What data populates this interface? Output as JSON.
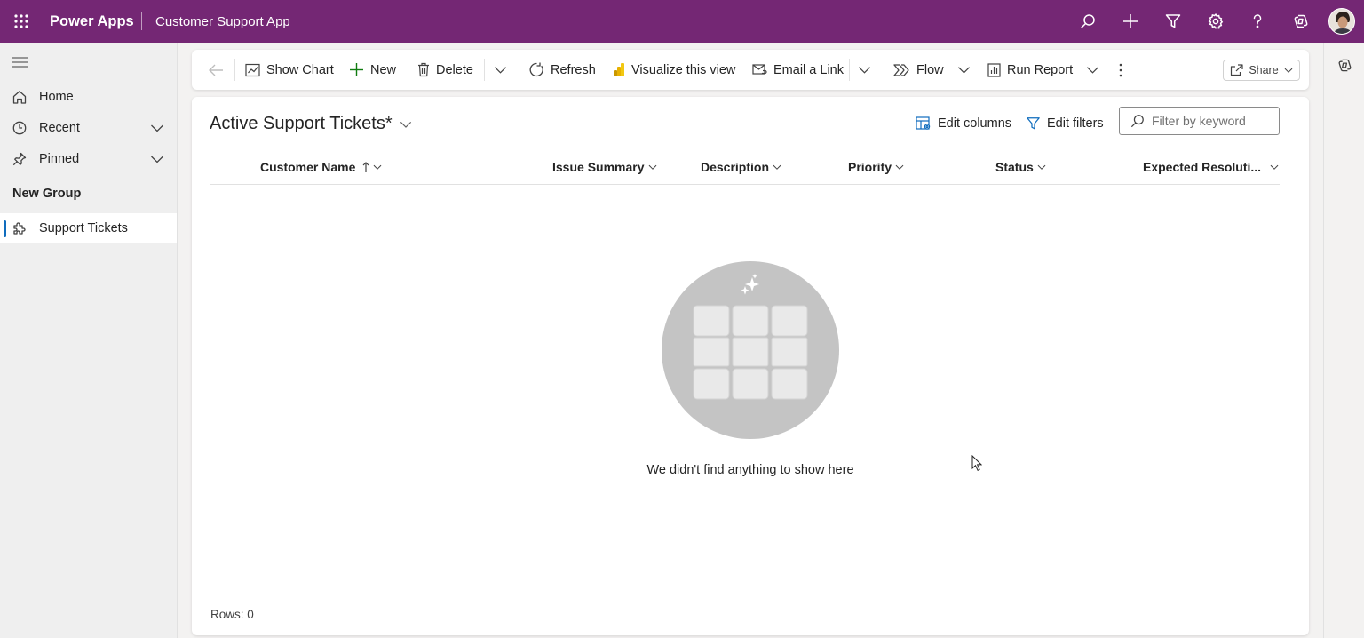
{
  "topbar": {
    "brand": "Power Apps",
    "app_name": "Customer Support App",
    "icons": [
      "waffle-icon",
      "search-icon",
      "plus-icon",
      "filter-icon",
      "settings-icon",
      "help-icon",
      "copilot-icon"
    ],
    "color": "#742774"
  },
  "sidebar": {
    "items": [
      {
        "label": "Home",
        "icon": "home-icon"
      },
      {
        "label": "Recent",
        "icon": "clock-icon"
      },
      {
        "label": "Pinned",
        "icon": "pin-icon"
      }
    ],
    "group_label": "New Group",
    "entity": {
      "label": "Support Tickets",
      "icon": "puzzle-icon"
    }
  },
  "commandbar": {
    "show_chart": "Show Chart",
    "new": "New",
    "delete": "Delete",
    "refresh": "Refresh",
    "visualize": "Visualize this view",
    "email_link": "Email a Link",
    "flow": "Flow",
    "run_report": "Run Report",
    "share": "Share"
  },
  "grid": {
    "view_title": "Active Support Tickets*",
    "edit_columns": "Edit columns",
    "edit_filters": "Edit filters",
    "keyword_placeholder": "Filter by keyword",
    "columns": [
      {
        "label": "Customer Name",
        "sorted": "ascending"
      },
      {
        "label": "Issue Summary"
      },
      {
        "label": "Description"
      },
      {
        "label": "Priority"
      },
      {
        "label": "Status"
      },
      {
        "label": "Expected Resoluti..."
      }
    ],
    "empty_message": "We didn't find anything to show here",
    "rows_label": "Rows: 0"
  },
  "accent": "#0f6cbd"
}
